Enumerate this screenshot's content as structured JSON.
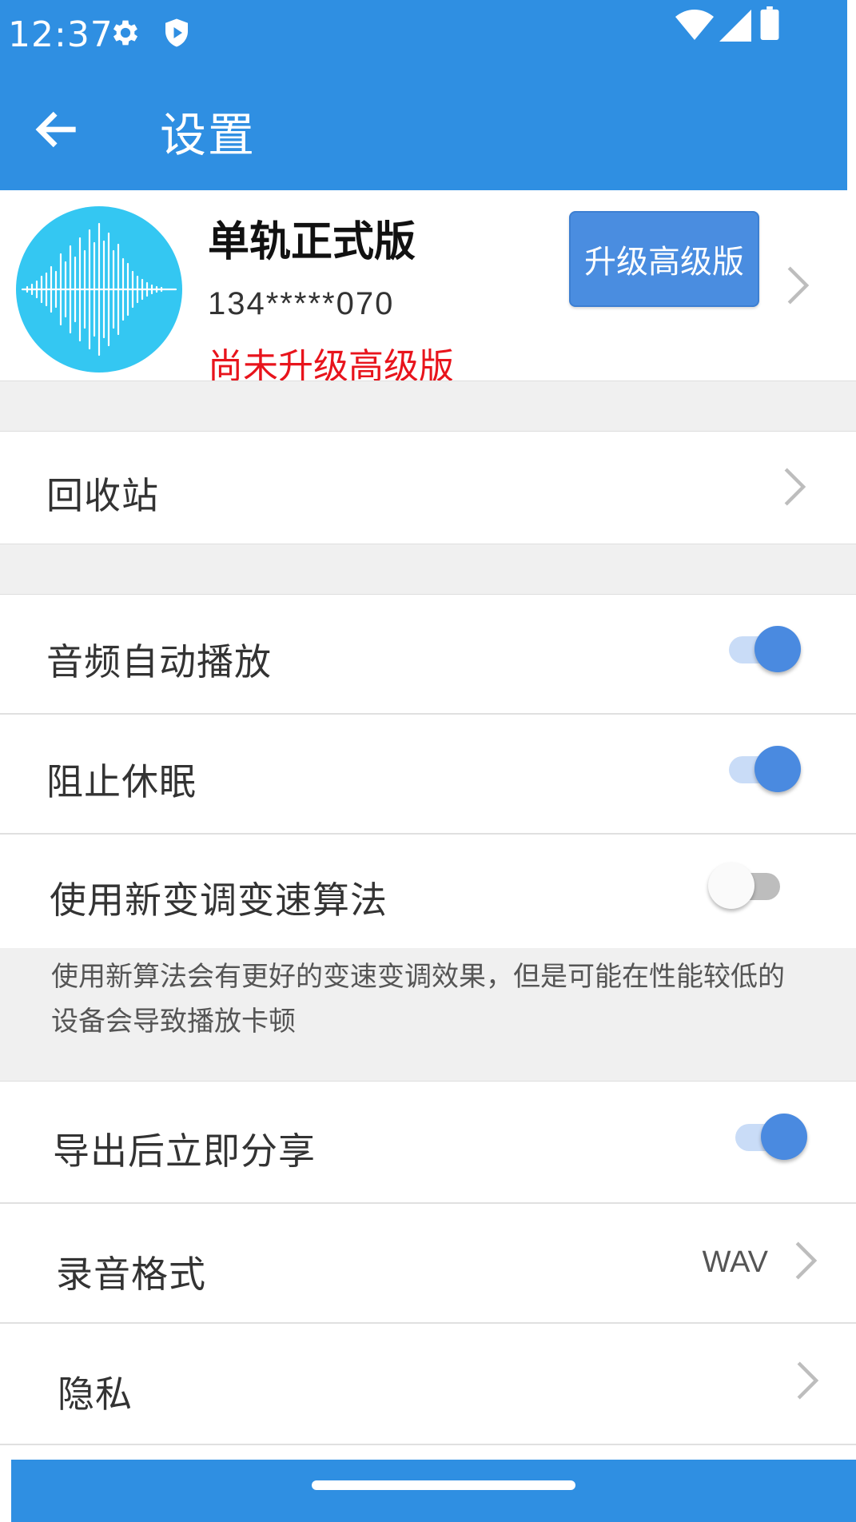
{
  "status_bar": {
    "time": "12:37",
    "icons": [
      "gear-icon",
      "shield-icon",
      "wifi-icon",
      "signal-icon",
      "battery-icon"
    ]
  },
  "app_bar": {
    "title": "设置",
    "back_icon": "arrow-left-icon"
  },
  "profile": {
    "name": "单轨正式版",
    "phone": "134*****070",
    "status": "尚未升级高级版",
    "upgrade_label": "升级高级版"
  },
  "settings": {
    "recycle_bin": "回收站",
    "auto_play": {
      "label": "音频自动播放",
      "enabled": true
    },
    "prevent_sleep": {
      "label": "阻止休眠",
      "enabled": true
    },
    "new_algorithm": {
      "label": "使用新变调变速算法",
      "enabled": false,
      "description": "使用新算法会有更好的变速变调效果，但是可能在性能较低的设备会导致播放卡顿"
    },
    "share_after_export": {
      "label": "导出后立即分享",
      "enabled": true
    },
    "record_format": {
      "label": "录音格式",
      "value": "WAV"
    },
    "privacy": "隐私"
  },
  "colors": {
    "primary": "#2f8fe2",
    "accent": "#4a8ae0",
    "warning_text": "#e8141c"
  }
}
